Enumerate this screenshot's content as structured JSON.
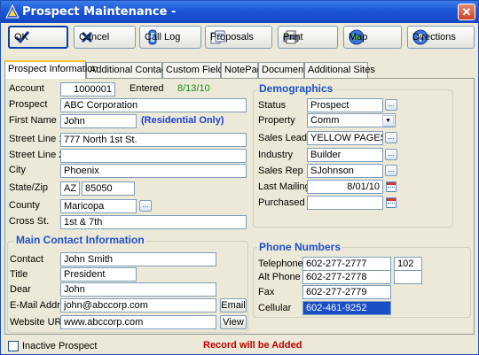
{
  "window": {
    "title": "Prospect Maintenance -",
    "close_glyph": "✕"
  },
  "toolbar": {
    "ok": "OK",
    "cancel": "Cancel",
    "call_log": "Call Log",
    "proposals": "Proposals",
    "print": "Print",
    "map": "Map",
    "directions": "Directions"
  },
  "tabs": [
    "Prospect Information",
    "Additional Contacts",
    "Custom Fields",
    "NotePad",
    "Documents",
    "Additional Sites"
  ],
  "prospect": {
    "account_label": "Account",
    "account_value": "1000001",
    "entered_label": "Entered",
    "entered_value": "8/13/10",
    "prospect_label": "Prospect",
    "prospect_value": "ABC Corporation",
    "firstname_label": "First Name",
    "firstname_value": "John",
    "residential_note": "(Residential Only)",
    "street1_label": "Street Line 1",
    "street1_value": "777 North 1st St.",
    "street2_label": "Street Line 2",
    "street2_value": "",
    "city_label": "City",
    "city_value": "Phoenix",
    "statezip_label": "State/Zip",
    "state_value": "AZ",
    "zip_value": "85050",
    "county_label": "County",
    "county_value": "Maricopa",
    "cross_label": "Cross St.",
    "cross_value": "1st & 7th",
    "dots": "..."
  },
  "demographics": {
    "title": "Demographics",
    "status_label": "Status",
    "status_value": "Prospect",
    "property_label": "Property",
    "property_value": "Comm",
    "saleslead_label": "Sales Lead",
    "saleslead_value": "YELLOW PAGES",
    "industry_label": "Industry",
    "industry_value": "Builder",
    "salesrep_label": "Sales Rep",
    "salesrep_value": "SJohnson",
    "lastmailing_label": "Last Mailing",
    "lastmailing_value": "8/01/10",
    "purchased_label": "Purchased",
    "purchased_value": ""
  },
  "contact": {
    "title": "Main Contact Information",
    "contact_label": "Contact",
    "contact_value": "John Smith",
    "title_label": "Title",
    "title_value": "President",
    "dear_label": "Dear",
    "dear_value": "John",
    "email_label": "E-Mail Addr",
    "email_value": "john@abccorp.com",
    "email_button": "Email",
    "website_label": "Website URL",
    "website_value": "www.abccorp.com",
    "view_button": "View"
  },
  "phones": {
    "title": "Phone Numbers",
    "telephone_label": "Telephone",
    "telephone_value": "602-277-2777",
    "telephone_ext": "102",
    "altphone_label": "Alt Phone",
    "altphone_value": "602-277-2778",
    "altphone_ext": "",
    "fax_label": "Fax",
    "fax_value": "602-277-2779",
    "cellular_label": "Cellular",
    "cellular_value": "602-461-9252"
  },
  "footer": {
    "inactive_label": "Inactive Prospect",
    "status_message": "Record will be Added",
    "status_color": "#c00000"
  },
  "colors": {
    "accent": "#1f50c8",
    "entered_date": "#1e8a1e",
    "residential": "#1f3fd0"
  }
}
